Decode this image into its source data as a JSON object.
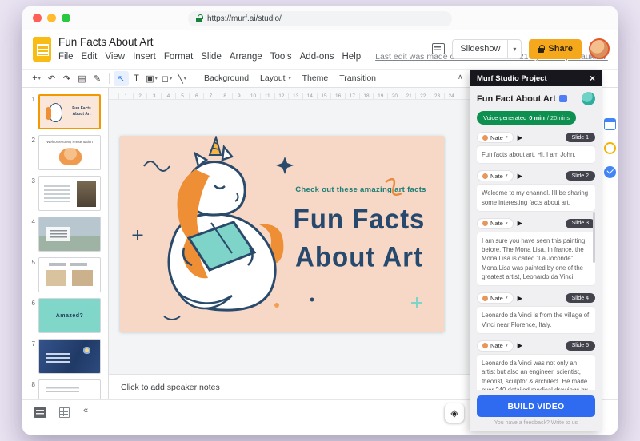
{
  "colors": {
    "share_button": "#f6a81c",
    "build_button": "#2e6bf0",
    "voice_badge": "#0e9150",
    "slide_background": "#f7d8c7",
    "slide_title": "#27496d",
    "slide_kicker": "#1d7d74",
    "selected_thumbnail_border": "#f29900"
  },
  "icons": {
    "play": "▶",
    "caret": "▾",
    "close": "×",
    "collapse": "«",
    "explore": "◈",
    "hide_menus": "∧"
  },
  "browser": {
    "url": "https://murf.ai/studio/"
  },
  "header": {
    "doc_title": "Fun Facts About Art",
    "menus": [
      "File",
      "Edit",
      "View",
      "Insert",
      "Format",
      "Slide",
      "Arrange",
      "Tools",
      "Add-ons",
      "Help"
    ],
    "last_edit": "Last edit was made on 7 December 2021 by Pankaj Chaukikar",
    "slideshow_label": "Slideshow",
    "share_label": "Share"
  },
  "toolbar": {
    "tools": [
      {
        "name": "new-slide",
        "glyph": "+",
        "caret": true
      },
      {
        "name": "undo",
        "glyph": "↶"
      },
      {
        "name": "redo",
        "glyph": "↷"
      },
      {
        "name": "print",
        "glyph": "▤"
      },
      {
        "name": "paint-format",
        "glyph": "✎",
        "divider_after": true
      },
      {
        "name": "select-tool",
        "glyph": "↖",
        "active": true
      },
      {
        "name": "text-box",
        "glyph": "T"
      },
      {
        "name": "insert-image",
        "glyph": "▣",
        "caret": true
      },
      {
        "name": "insert-shape",
        "glyph": "◻",
        "caret": true
      },
      {
        "name": "insert-line",
        "glyph": "╲",
        "caret": true,
        "divider_after": true
      }
    ],
    "buttons": [
      {
        "label": "Background"
      },
      {
        "label": "Layout",
        "caret": true
      },
      {
        "label": "Theme"
      },
      {
        "label": "Transition"
      }
    ]
  },
  "ruler": [
    "1",
    "2",
    "3",
    "4",
    "5",
    "6",
    "7",
    "8",
    "9",
    "10",
    "11",
    "12",
    "13",
    "14",
    "15",
    "16",
    "17",
    "18",
    "19",
    "20",
    "21",
    "22",
    "23",
    "24"
  ],
  "filmstrip": [
    {
      "n": "1",
      "kind": "unicorn",
      "caption": "Fun Facts About Art",
      "selected": true
    },
    {
      "n": "2",
      "kind": "welcome",
      "caption": "Welcome to My Presentation"
    },
    {
      "n": "3",
      "kind": "monalisa",
      "caption": ""
    },
    {
      "n": "4",
      "kind": "photo",
      "caption": ""
    },
    {
      "n": "5",
      "kind": "papers",
      "caption": ""
    },
    {
      "n": "6",
      "kind": "amazed",
      "caption": "Amazed?"
    },
    {
      "n": "7",
      "kind": "starry",
      "caption": ""
    },
    {
      "n": "8",
      "kind": "plain",
      "caption": ""
    }
  ],
  "slide": {
    "kicker": "Check out these amazing art facts",
    "title_line1": "Fun Facts",
    "title_line2": "About Art"
  },
  "notes_placeholder": "Click to add speaker notes",
  "murf": {
    "panel_title": "Murf Studio Project",
    "project_title": "Fun Fact About Art",
    "voice_generated_label": "Voice generated",
    "voice_minutes": "0 min",
    "voice_total": "/ 20mins",
    "build_button": "BUILD VIDEO",
    "feedback": "You have a feedback? Write to us",
    "blocks": [
      {
        "voice": "Nate",
        "slide_label": "Slide 1",
        "text": "Fun facts about art. Hi, I am John."
      },
      {
        "voice": "Nate",
        "slide_label": "Slide 2",
        "text": "Welcome to my channel. I'll be sharing some interesting facts about art."
      },
      {
        "voice": "Nate",
        "slide_label": "Slide 3",
        "text": "I am sure you have seen this painting before. The Mona Lisa. In france, the Mona Lisa is called \"La Joconde\". Mona Lisa was painted by one of the greatest artist, Leonardo da Vinci."
      },
      {
        "voice": "Nate",
        "slide_label": "Slide 4",
        "text": "Leonardo da Vinci is from the village of Vinci near Florence, Italy."
      },
      {
        "voice": "Nate",
        "slide_label": "Slide 5",
        "text": "Leonardo da Vinci was not only an artist but also an engineer, scientist, theorist, sculptor & architect. He made over 240 detailed medical drawings by studying..."
      }
    ]
  }
}
